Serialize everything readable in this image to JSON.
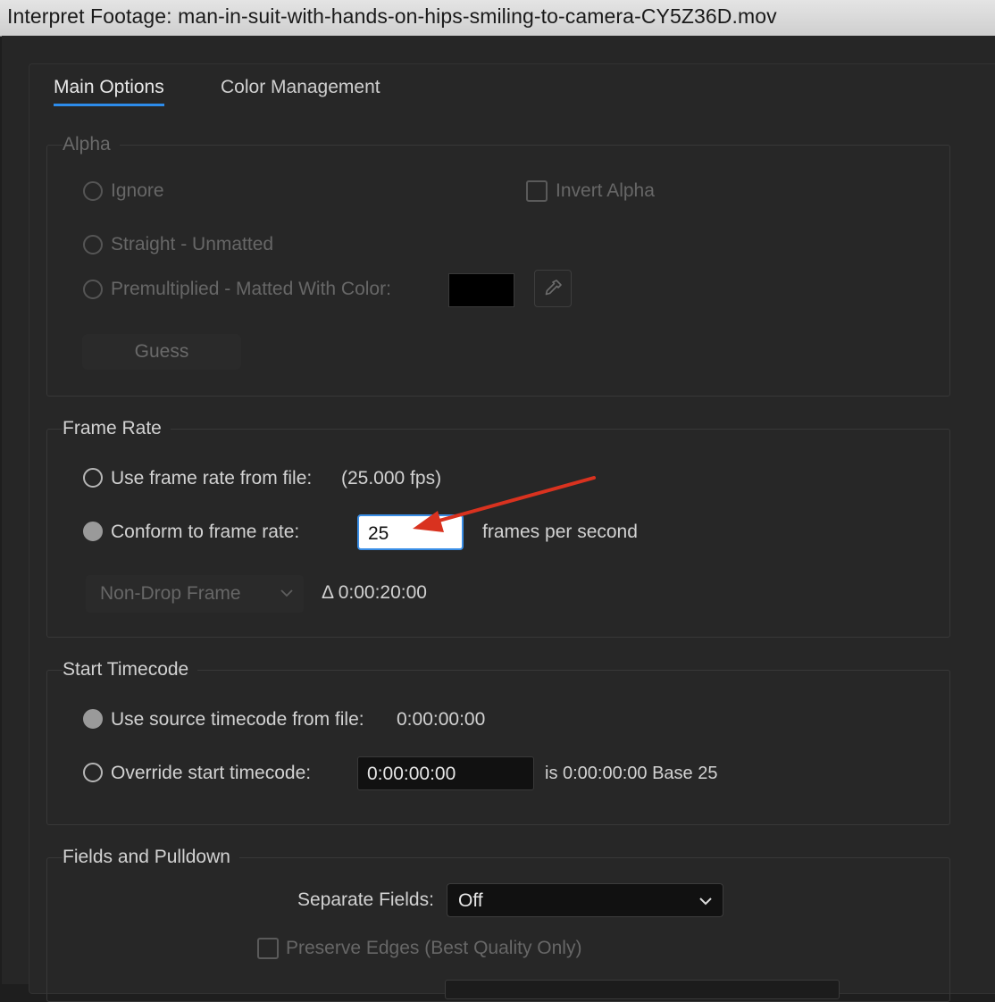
{
  "window": {
    "title": "Interpret Footage: man-in-suit-with-hands-on-hips-smiling-to-camera-CY5Z36D.mov"
  },
  "tabs": [
    {
      "label": "Main Options",
      "active": true
    },
    {
      "label": "Color Management",
      "active": false
    }
  ],
  "alpha": {
    "label": "Alpha",
    "options": [
      "Ignore",
      "Straight - Unmatted",
      "Premultiplied - Matted With Color:"
    ],
    "invert_label": "Invert Alpha",
    "matte_color": "#000000",
    "eyedropper_icon": "eyedropper-icon",
    "guess_label": "Guess"
  },
  "frame_rate": {
    "label": "Frame Rate",
    "use_file_label": "Use frame rate from file:",
    "file_fps": "(25.000 fps)",
    "conform_label": "Conform to frame rate:",
    "conform_value": "25",
    "fps_unit": "frames per second",
    "drop_frame_value": "Non-Drop Frame",
    "duration": "Δ 0:00:20:00"
  },
  "start_timecode": {
    "label": "Start Timecode",
    "source_label": "Use source timecode from file:",
    "source_value": "0:00:00:00",
    "override_label": "Override start timecode:",
    "override_value": "0:00:00:00",
    "override_info": "is 0:00:00:00  Base 25"
  },
  "fields": {
    "label": "Fields and Pulldown",
    "separate_label": "Separate Fields:",
    "separate_value": "Off",
    "preserve_label": "Preserve Edges (Best Quality Only)"
  },
  "colors": {
    "accent": "#2d8ceb",
    "annotation_arrow": "#d9321f"
  }
}
